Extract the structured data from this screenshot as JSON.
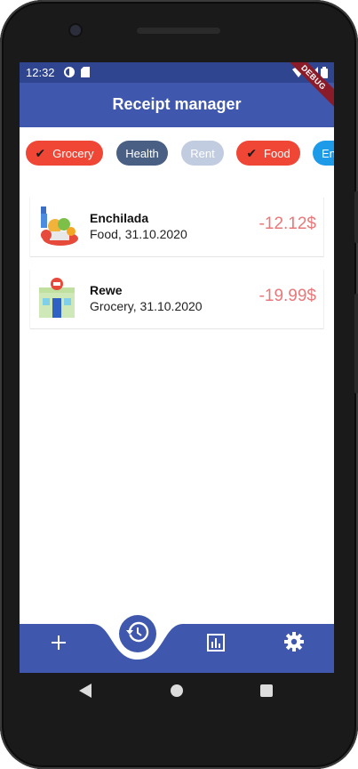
{
  "status": {
    "time": "12:32"
  },
  "app": {
    "title": "Receipt manager",
    "debug_label": "DEBUG"
  },
  "chips": [
    {
      "label": "Grocery",
      "selected": true,
      "color": "#f04636"
    },
    {
      "label": "Health",
      "selected": false,
      "color": "#4a5f84"
    },
    {
      "label": "Rent",
      "selected": false,
      "color": "#c2cce0"
    },
    {
      "label": "Food",
      "selected": true,
      "color": "#f04636"
    },
    {
      "label": "En",
      "selected": false,
      "color": "#1e9be8"
    }
  ],
  "receipts": [
    {
      "title": "Enchilada",
      "subtitle": "Food, 31.10.2020",
      "amount": "-12.12$",
      "icon": "grocery-bag-icon"
    },
    {
      "title": "Rewe",
      "subtitle": "Grocery, 31.10.2020",
      "amount": "-19.99$",
      "icon": "store-front-icon"
    }
  ],
  "bottom_nav": [
    {
      "icon": "add-icon"
    },
    {
      "icon": "history-icon",
      "active": true
    },
    {
      "icon": "chart-icon"
    },
    {
      "icon": "settings-icon"
    }
  ],
  "colors": {
    "primary": "#3f58ad",
    "status_bar": "#2f4590",
    "amount": "#e8787a"
  }
}
